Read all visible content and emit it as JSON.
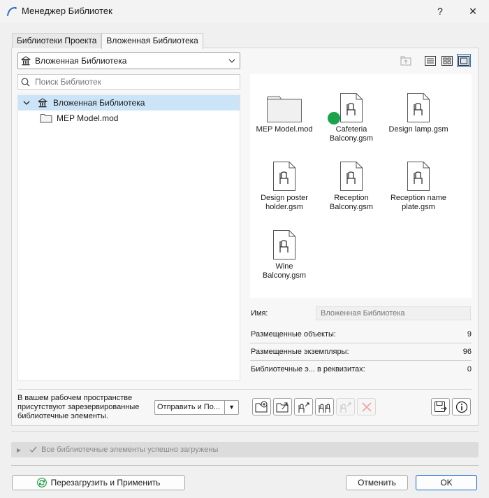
{
  "window": {
    "title": "Менеджер Библиотек",
    "help_label": "?",
    "close_label": "✕"
  },
  "tabs": [
    {
      "label": "Библиотеки Проекта",
      "active": false
    },
    {
      "label": "Вложенная Библиотека",
      "active": true
    }
  ],
  "library_select": {
    "value": "Вложенная Библиотека"
  },
  "view_modes": [
    "list",
    "detail",
    "thumbnails"
  ],
  "view_mode_selected": "thumbnails",
  "search": {
    "placeholder": "Поиск Библиотек"
  },
  "tree": [
    {
      "label": "Вложенная Библиотека",
      "expanded": true,
      "selected": true
    },
    {
      "label": "MEP Model.mod",
      "selected": false
    }
  ],
  "items": [
    {
      "line1": "MEP Model.mod",
      "line2": "",
      "icon": "folder-icon"
    },
    {
      "line1": "Cafeteria",
      "line2": "Balcony.gsm",
      "icon": "gsm-file-icon",
      "placed_marker": true
    },
    {
      "line1": "Design lamp.gsm",
      "line2": "",
      "icon": "gsm-file-icon"
    },
    {
      "line1": "Design poster",
      "line2": "holder.gsm",
      "icon": "gsm-file-icon"
    },
    {
      "line1": "Reception",
      "line2": "Balcony.gsm",
      "icon": "gsm-file-icon"
    },
    {
      "line1": "Reception name",
      "line2": "plate.gsm",
      "icon": "gsm-file-icon"
    },
    {
      "line1": "Wine",
      "line2": "Balcony.gsm",
      "icon": "gsm-file-icon"
    }
  ],
  "details": {
    "name_label": "Имя:",
    "name_value": "Вложенная Библиотека",
    "placed_objects_label": "Размещенные объекты:",
    "placed_objects_value": "9",
    "placed_instances_label": "Размещенные экземпляры:",
    "placed_instances_value": "96",
    "library_in_props_label": "Библиотечные э... в реквизитах:",
    "library_in_props_value": "0"
  },
  "reserved_message": "В вашем рабочем пространстве присутствуют зарезервированные библиотечные элементы.",
  "send_button": {
    "label": "Отправить и По..."
  },
  "status": {
    "text": "Все библиотечные элементы успешно загружены"
  },
  "footer": {
    "reload_label": "Перезагрузить и Применить",
    "cancel_label": "Отменить",
    "ok_label": "OK"
  },
  "colors": {
    "selection": "#cce4f7",
    "accent": "#0a64c8",
    "placed_marker": "#1ba34b"
  }
}
